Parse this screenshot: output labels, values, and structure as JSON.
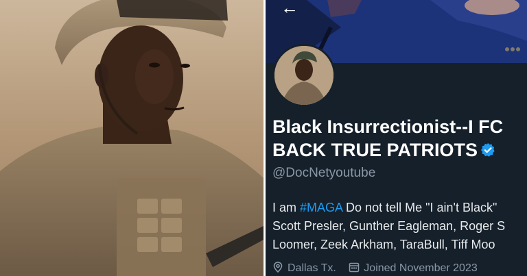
{
  "profile": {
    "display_name_line1": "Black Insurrectionist--I FC",
    "display_name_line2": "BACK TRUE PATRIOTS",
    "handle": "@DocNetyoutube",
    "bio": {
      "prefix": "I am ",
      "hashtag": "#MAGA",
      "line1_rest": " Do not tell Me \"I ain't Black\"",
      "line2": "Scott Presler, Gunther Eagleman, Roger S",
      "line3": "Loomer, Zeek Arkham, TaraBull, Tiff Moo"
    },
    "location": "Dallas Tx.",
    "joined": "Joined November 2023"
  },
  "icons": {
    "back": "back-arrow-icon",
    "verified": "verified-badge-icon",
    "location": "location-pin-icon",
    "calendar": "calendar-icon"
  },
  "colors": {
    "background": "#15202b",
    "accent": "#1d9bf0",
    "secondary_text": "#8b98a5",
    "primary_text": "#e7e9ea"
  }
}
